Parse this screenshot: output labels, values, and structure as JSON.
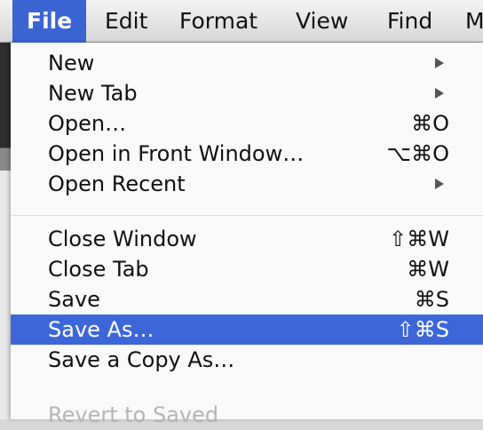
{
  "menubar": {
    "items": [
      "File",
      "Edit",
      "Format",
      "View",
      "Find",
      "M"
    ]
  },
  "file_menu": {
    "items": [
      {
        "label": "New",
        "shortcut": "",
        "submenu": true
      },
      {
        "label": "New Tab",
        "shortcut": "",
        "submenu": true
      },
      {
        "label": "Open…",
        "shortcut": "⌘O",
        "submenu": false
      },
      {
        "label": "Open in Front Window…",
        "shortcut": "⌥⌘O",
        "submenu": false
      },
      {
        "label": "Open Recent",
        "shortcut": "",
        "submenu": true
      },
      {
        "label": "Close Window",
        "shortcut": "⇧⌘W",
        "submenu": false
      },
      {
        "label": "Close Tab",
        "shortcut": "⌘W",
        "submenu": false
      },
      {
        "label": "Save",
        "shortcut": "⌘S",
        "submenu": false
      },
      {
        "label": "Save As…",
        "shortcut": "⇧⌘S",
        "submenu": false,
        "selected": true
      },
      {
        "label": "Save a Copy As…",
        "shortcut": "",
        "submenu": false
      },
      {
        "label": "Revert to Saved",
        "shortcut": "",
        "submenu": false,
        "partially_visible": true
      }
    ]
  },
  "colors": {
    "selection": "#3d67d8",
    "active_menubar": "#3b64d3"
  }
}
